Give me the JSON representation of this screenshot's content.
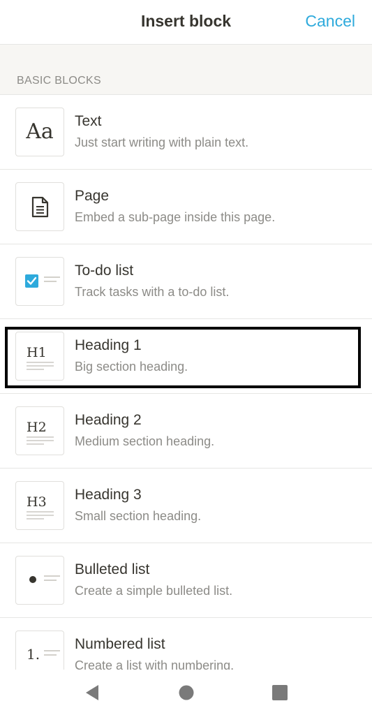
{
  "header": {
    "title": "Insert block",
    "cancel_label": "Cancel"
  },
  "section": {
    "label": "BASIC BLOCKS"
  },
  "items": [
    {
      "title": "Text",
      "description": "Just start writing with plain text.",
      "icon": "text-aa-icon",
      "icon_text": "Aa"
    },
    {
      "title": "Page",
      "description": "Embed a sub-page inside this page.",
      "icon": "page-document-icon"
    },
    {
      "title": "To-do list",
      "description": "Track tasks with a to-do list.",
      "icon": "checkbox-icon"
    },
    {
      "title": "Heading 1",
      "description": "Big section heading.",
      "icon": "heading-1-icon",
      "icon_text": "H1"
    },
    {
      "title": "Heading 2",
      "description": "Medium section heading.",
      "icon": "heading-2-icon",
      "icon_text": "H2"
    },
    {
      "title": "Heading 3",
      "description": "Small section heading.",
      "icon": "heading-3-icon",
      "icon_text": "H3"
    },
    {
      "title": "Bulleted list",
      "description": "Create a simple bulleted list.",
      "icon": "bullet-list-icon"
    },
    {
      "title": "Numbered list",
      "description": "Create a list with numbering.",
      "icon": "numbered-list-icon",
      "icon_text": "1."
    }
  ],
  "colors": {
    "accent": "#2eaadc",
    "text_primary": "#37352f",
    "text_secondary": "#8c8b87",
    "section_bg": "#f7f6f3",
    "checkbox": "#2eaadc"
  },
  "navigation": {
    "back_icon": "back-triangle-icon",
    "home_icon": "home-circle-icon",
    "recents_icon": "recents-square-icon"
  }
}
